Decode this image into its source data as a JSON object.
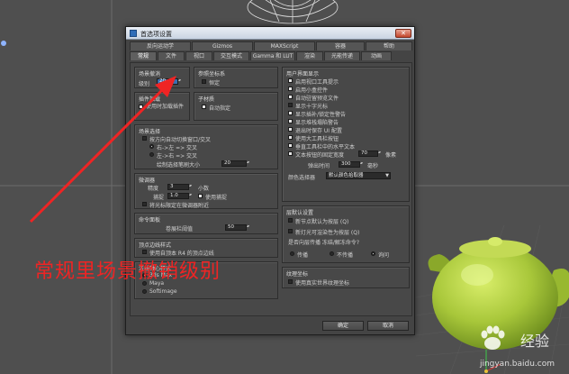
{
  "dialog": {
    "title": "首选项设置",
    "close_label": "✕",
    "tabs_row1": [
      "反向运动学",
      "Gizmos",
      "MAXScript",
      "容器",
      "帮助"
    ],
    "tabs_row2": [
      "常规",
      "文件",
      "视口",
      "交互模式",
      "Gamma 和 LUT",
      "渲染",
      "光能传递",
      "动画"
    ],
    "active_tab": "常规",
    "ok_label": "确定",
    "cancel_label": "取消"
  },
  "scene_undo": {
    "title": "场景撤消",
    "levels_label": "级别",
    "levels_value": "20"
  },
  "ref_coord": {
    "title": "参照坐标系",
    "constant_label": "恒定"
  },
  "plugin_loading": {
    "title": "插件加载",
    "load_on_use_label": "使用时加载插件"
  },
  "sub_material": {
    "title": "子材质",
    "auto_assign_label": "自动指定"
  },
  "scene_selection": {
    "title": "场景选择",
    "auto_window_crossing_label": "按方向自动切换窗口/交叉",
    "right_to_left_label": "右->左 => 交叉",
    "left_to_right_label": "左->右 => 交叉",
    "paint_brush_size_label": "绘制选择笔刷大小",
    "paint_brush_size_value": "20"
  },
  "ui_display": {
    "title": "用户界面显示",
    "items": [
      {
        "label": "启用视口工具提示",
        "checked": true
      },
      {
        "label": "启用小盒控件",
        "checked": true
      },
      {
        "label": "自动驻留预览文件",
        "checked": true
      },
      {
        "label": "显示十字光标",
        "checked": false
      },
      {
        "label": "显示插补/锁定性警告",
        "checked": true
      },
      {
        "label": "显示堆栈塌陷警告",
        "checked": true
      },
      {
        "label": "退出时保存 UI 配置",
        "checked": true
      },
      {
        "label": "使用大工具栏按钮",
        "checked": true
      },
      {
        "label": "垂直工具栏中的水平文本",
        "checked": true
      },
      {
        "label": "文本按钮的固定宽度",
        "checked": true
      }
    ],
    "text_width_value": "70",
    "text_width_unit": "像素",
    "flyout_time_label": "弹出时间",
    "flyout_time_value": "300",
    "flyout_time_unit": "毫秒",
    "color_picker_label": "颜色选择器",
    "color_picker_value": "默认颜色拾取器"
  },
  "spinners": {
    "title": "微调器",
    "precision_label": "精度",
    "precision_value": "3",
    "precision_unit": "小数",
    "snap_label": "捕捉",
    "snap_value": "1.0",
    "use_snap_label": "使用捕捉",
    "wrap_cursor_label": "将光标限定在微调器附近"
  },
  "command_panel": {
    "title": "命令面板",
    "rollup_label": "卷展栏阈值",
    "rollup_value": "50"
  },
  "vertex_dots": {
    "title": "顶点边线样式",
    "use_r4_label": "使用自顶本 R4 的顶点边线"
  },
  "gizmo_style": {
    "title": "法线轴心样式",
    "options": [
      "3ds Max",
      "Maya",
      "Softimage"
    ]
  },
  "layer_defaults": {
    "title": "层默认设置",
    "new_by_layer_label": "新节点默认为按层 (Q)",
    "new_by_layer_ext_label": "新灯光可渲染性为按层 (Q)",
    "question_label": "是否向层传播 冻结/解冻命令?",
    "options": [
      "传播",
      "不传播",
      "询问"
    ]
  },
  "texture_coords": {
    "title": "纹理坐标",
    "use_real_world_label": "使用真实世界纹理坐标"
  },
  "annotation": {
    "text": "常规里场景撤销级别"
  },
  "watermark": {
    "name": "经验",
    "url": "jingyan.baidu.com"
  }
}
